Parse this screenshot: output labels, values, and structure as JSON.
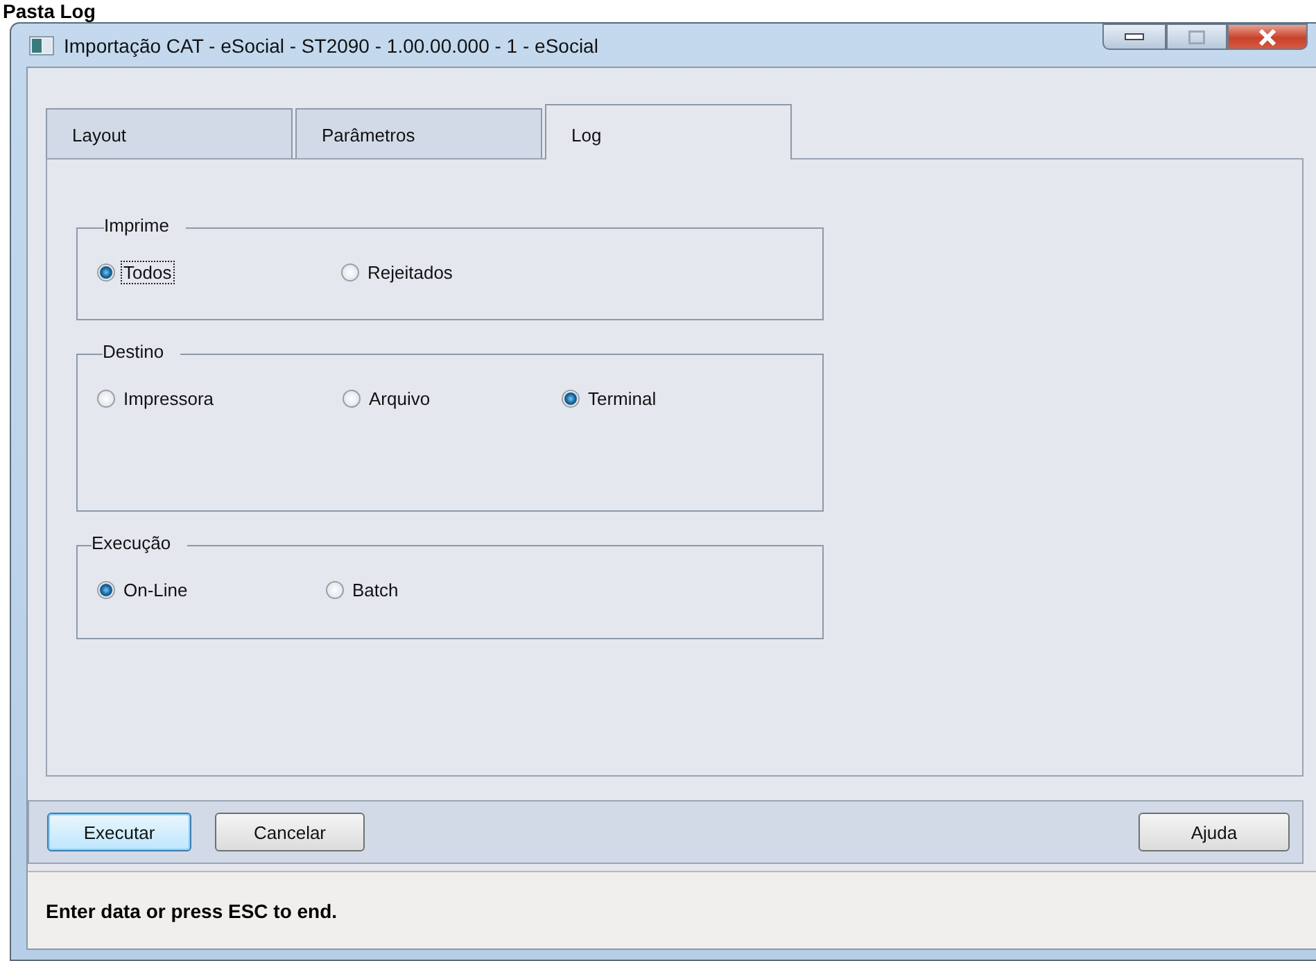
{
  "heading": "Pasta Log",
  "window": {
    "title": "Importação CAT - eSocial - ST2090 - 1.00.00.000 - 1 - eSocial"
  },
  "tabs": [
    {
      "label": "Layout",
      "selected": false
    },
    {
      "label": "Parâmetros",
      "selected": false
    },
    {
      "label": "Log",
      "selected": true
    }
  ],
  "groups": [
    {
      "title": "Imprime",
      "options": [
        {
          "label": "Todos",
          "selected": true,
          "focused": true
        },
        {
          "label": "Rejeitados",
          "selected": false,
          "focused": false
        }
      ]
    },
    {
      "title": "Destino",
      "options": [
        {
          "label": "Impressora",
          "selected": false,
          "focused": false
        },
        {
          "label": "Arquivo",
          "selected": false,
          "focused": false
        },
        {
          "label": "Terminal",
          "selected": true,
          "focused": false
        }
      ]
    },
    {
      "title": "Execução",
      "options": [
        {
          "label": "On-Line",
          "selected": true,
          "focused": false
        },
        {
          "label": "Batch",
          "selected": false,
          "focused": false
        }
      ]
    }
  ],
  "buttons": [
    {
      "label": "Executar",
      "default": true
    },
    {
      "label": "Cancelar",
      "default": false
    }
  ],
  "right_buttons": [
    {
      "label": "Ajuda",
      "default": false
    }
  ],
  "status_bar": "Enter data or press ESC to end."
}
